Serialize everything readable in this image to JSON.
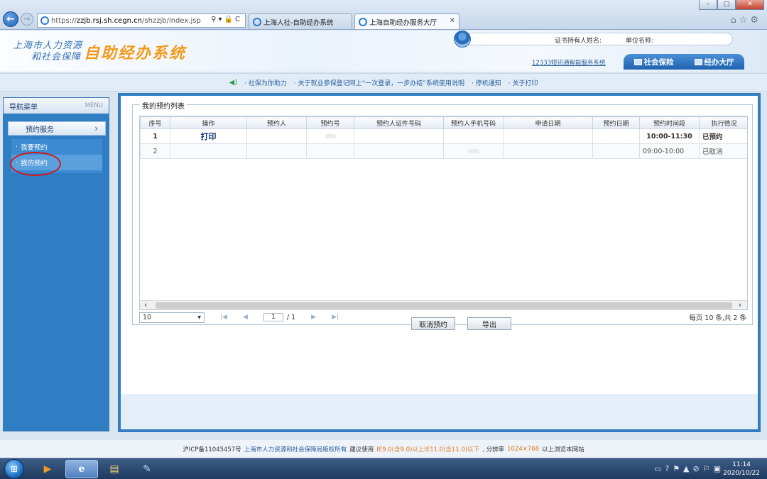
{
  "browser": {
    "url_prefix": "https://",
    "url_domain": "zzjb.rsj.sh.cegn.cn",
    "url_path": "/shzzjb/index.jsp",
    "tabs": [
      {
        "label": "上海人社-自助经办系统"
      },
      {
        "label": "上海自助经办服务大厅"
      }
    ],
    "window_controls": [
      "–",
      "□",
      "✕"
    ]
  },
  "header": {
    "logo_line1": "上海市人力资源",
    "logo_line2": "和社会保障",
    "logo_title": "自助经办系统",
    "holder_label": "证书持有人姓名:",
    "unit_label": "单位名称:",
    "service_link": "12333短讯通智能服务系统",
    "tabs": [
      {
        "label": "社会保险"
      },
      {
        "label": "经办大厅"
      }
    ]
  },
  "notice": {
    "items": [
      "社保为你助力",
      "关于就业参保登记网上“一次登录，一步办结”系统使用说明",
      "停机通知",
      "关于打印"
    ]
  },
  "sidebar": {
    "title": "导航菜单",
    "menu_label": "MENU",
    "group": "预约服务",
    "items": [
      {
        "label": "我要预约"
      },
      {
        "label": "我的预约"
      }
    ]
  },
  "main": {
    "legend": "我的预约列表",
    "columns": [
      "序号",
      "操作",
      "预约人",
      "预约号",
      "预约人证件号码",
      "预约人手机号码",
      "申请日期",
      "预约日期",
      "预约时间段",
      "执行情况"
    ],
    "rows": [
      {
        "no": "1",
        "action": "打印",
        "time": "10:00-11:30",
        "status": "已预约"
      },
      {
        "no": "2",
        "action": "",
        "time": "09:00-10:00",
        "status": "已取消"
      }
    ],
    "pager": {
      "page_size": "10",
      "current_page": "1",
      "total_pages": "/ 1",
      "info": "每页 10 条,共 2 条"
    },
    "buttons": {
      "cancel": "取消预约",
      "export": "导出"
    }
  },
  "footer": {
    "icp": "沪ICP备11045457号",
    "copyright": "上海市人力资源和社会保障局版权所有",
    "suggest_prefix": "建议使用",
    "ie_version": "IE9.0(含9.0)以上IE11.0(含11.0)以下",
    "resolution_prefix": ", 分辨率",
    "resolution": "1024×768",
    "suggest_suffix": "以上浏览本网站"
  },
  "taskbar": {
    "time": "11:14",
    "date": "2020/10/22"
  },
  "colors": {
    "accent": "#2f7dc3",
    "logo_title": "#f09a1e",
    "circle": "#d4191d"
  }
}
